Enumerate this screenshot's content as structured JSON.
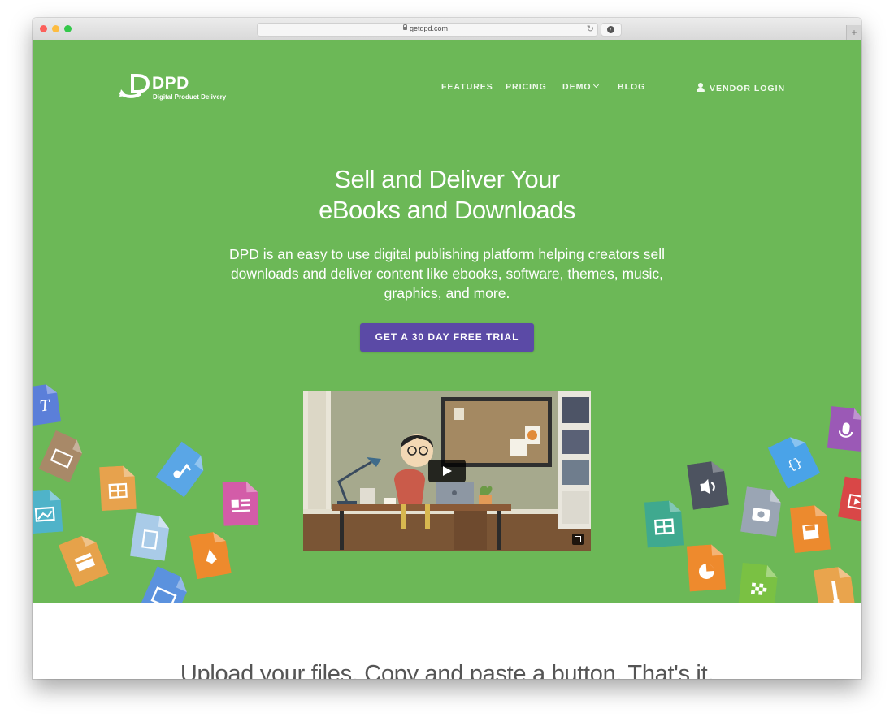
{
  "browser": {
    "url": "getdpd.com",
    "new_tab_label": "+"
  },
  "brand": {
    "name": "DPD",
    "tagline": "Digital Product Delivery"
  },
  "nav": {
    "features": "FEATURES",
    "pricing": "PRICING",
    "demo": "DEMO",
    "blog": "BLOG",
    "vendor_login": "VENDOR LOGIN"
  },
  "hero": {
    "headline_line1": "Sell and Deliver Your",
    "headline_line2": "eBooks and Downloads",
    "subtext": "DPD is an easy to use digital publishing platform helping creators sell downloads and deliver content like ebooks, software, themes, music, graphics, and more.",
    "cta": "GET A 30 DAY FREE TRIAL"
  },
  "video": {
    "play_icon": "play-icon",
    "fullscreen_icon": "fullscreen-icon"
  },
  "file_icons": [
    {
      "name": "text-file-icon",
      "color": "#5b7fd9",
      "glyph": "T"
    },
    {
      "name": "document-file-icon",
      "color": "#a88968",
      "glyph": "▤"
    },
    {
      "name": "image-file-icon",
      "color": "#4fb3c9",
      "glyph": "▧"
    },
    {
      "name": "spreadsheet-file-icon",
      "color": "#e7a24d",
      "glyph": "▦"
    },
    {
      "name": "archive-file-icon",
      "color": "#e6a24a",
      "glyph": "▬"
    },
    {
      "name": "music-file-icon",
      "color": "#5aa6e6",
      "glyph": "♪"
    },
    {
      "name": "generic-file-icon",
      "color": "#a9cbe8",
      "glyph": "▯"
    },
    {
      "name": "window-file-icon",
      "color": "#5b92de",
      "glyph": "▭"
    },
    {
      "name": "news-file-icon",
      "color": "#d35ca8",
      "glyph": "▤"
    },
    {
      "name": "pen-file-icon",
      "color": "#ee8a2d",
      "glyph": "✎"
    },
    {
      "name": "microphone-file-icon",
      "color": "#9b59b6",
      "glyph": "●"
    },
    {
      "name": "code-file-icon",
      "color": "#4aa3e8",
      "glyph": "{}"
    },
    {
      "name": "audio-file-icon",
      "color": "#4d5360",
      "glyph": "◀)"
    },
    {
      "name": "table-file-icon",
      "color": "#3fa98f",
      "glyph": "▦"
    },
    {
      "name": "camera-file-icon",
      "color": "#9aa5b4",
      "glyph": "◉"
    },
    {
      "name": "video-file-icon",
      "color": "#d94747",
      "glyph": "▶"
    },
    {
      "name": "floppy-file-icon",
      "color": "#ec8a2e",
      "glyph": "■"
    },
    {
      "name": "pie-chart-file-icon",
      "color": "#ee8a2d",
      "glyph": "◔"
    },
    {
      "name": "checker-file-icon",
      "color": "#7ac143",
      "glyph": "▩"
    },
    {
      "name": "zip-file-icon",
      "color": "#e9a44d",
      "glyph": "≡"
    }
  ],
  "section2": {
    "title": "Upload your files. Copy and paste a button. That's it."
  }
}
